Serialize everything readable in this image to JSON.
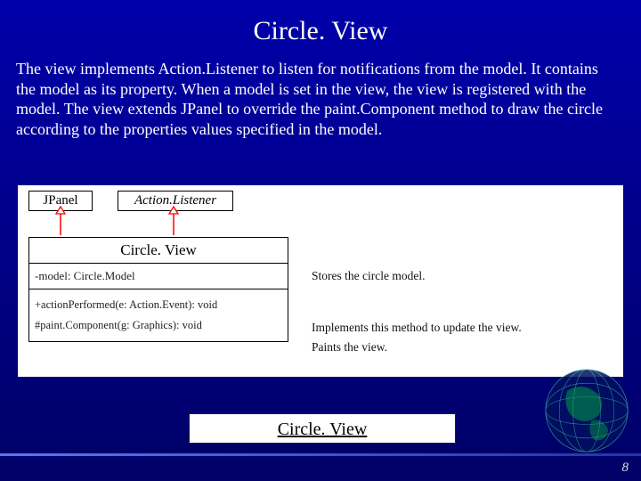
{
  "title": "Circle. View",
  "body": "The view implements Action.Listener to listen for notifications from the model. It contains the model as its property. When a model is set in the view, the view is registered with the model. The view extends JPanel to override the paint.Component method to draw the circle according to the properties values specified in the model.",
  "uml": {
    "jpanel": "JPanel",
    "actionlistener": "Action.Listener",
    "classname": "Circle. View",
    "attribute": "-model: Circle.Model",
    "op1": "+actionPerformed(e: Action.Event): void",
    "op2": "#paint.Component(g: Graphics): void",
    "note1": "Stores the circle model.",
    "note2": "Implements this method to update the view.",
    "note3": "Paints the view."
  },
  "button": "Circle. View",
  "page": "8"
}
